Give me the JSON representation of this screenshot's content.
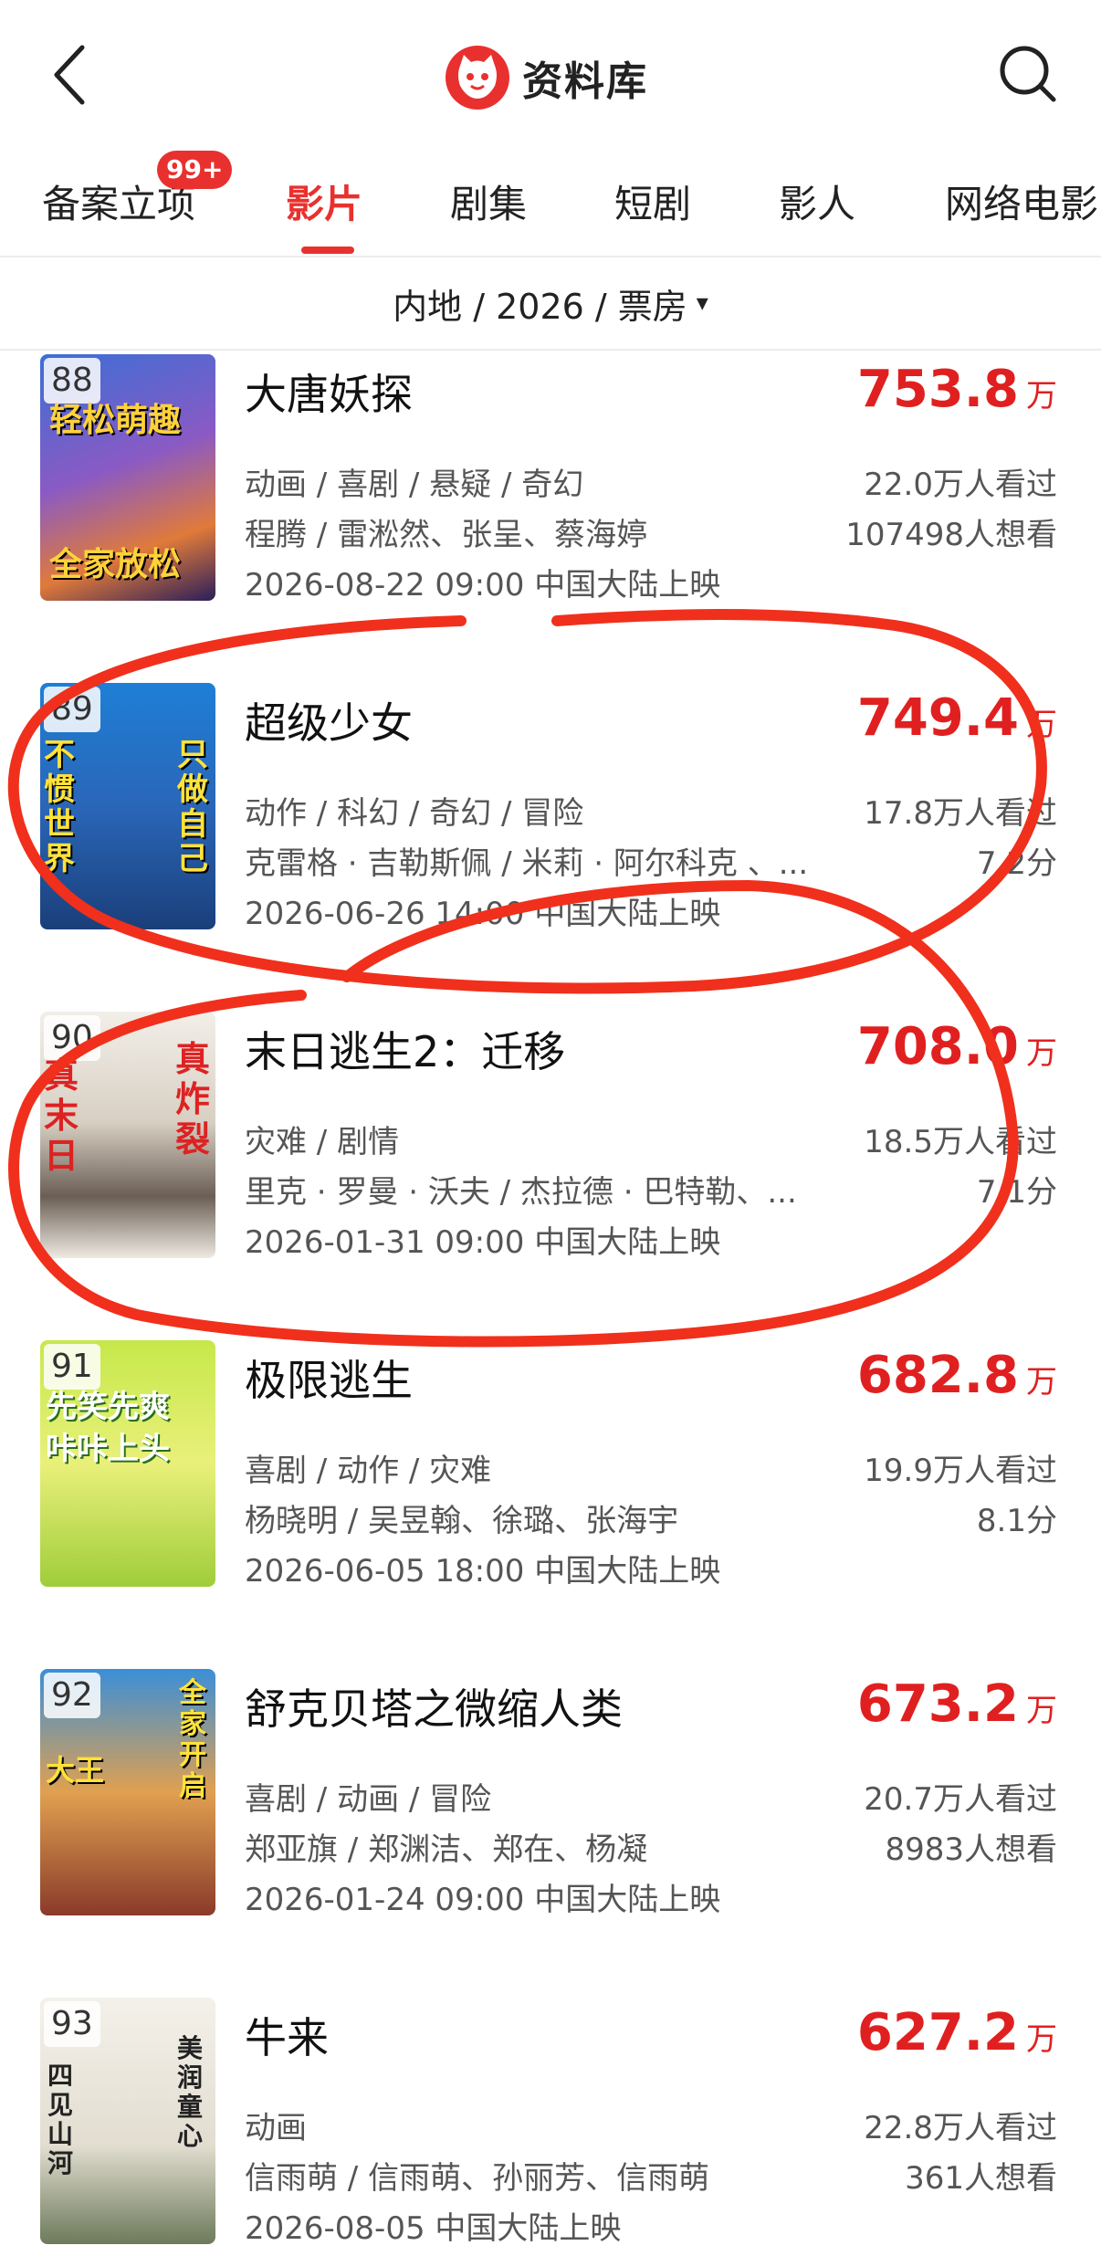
{
  "header": {
    "title": "资料库",
    "back_icon": "chevron-left-icon",
    "search_icon": "search-icon",
    "logo_icon": "cat-logo-icon"
  },
  "tabs": [
    {
      "label": "备案立项",
      "badge": "99+"
    },
    {
      "label": "影片"
    },
    {
      "label": "剧集"
    },
    {
      "label": "短剧"
    },
    {
      "label": "影人"
    },
    {
      "label": "网络电影"
    }
  ],
  "active_tab": "影片",
  "filter": {
    "label": "内地 / 2026 / 票房",
    "caret": "▾"
  },
  "colors": {
    "accent": "#e8312f",
    "box_office": "#e02020",
    "annotation": "#f0301c"
  },
  "movies": [
    {
      "rank": "88",
      "title": "大唐妖探",
      "box_office": "753.8",
      "unit": "万",
      "genres": "动画 / 喜剧 / 悬疑 / 奇幻",
      "people": "程腾 / 雷淞然、张呈、蔡海婷",
      "release": "2026-08-22 09:00 中国大陆上映",
      "watched": "22.0万人看过",
      "second": "107498人想看",
      "poster_text": [
        "轻松萌趣",
        "全家放松"
      ]
    },
    {
      "rank": "89",
      "title": "超级少女",
      "box_office": "749.4",
      "unit": "万",
      "genres": "动作 / 科幻 / 奇幻 / 冒险",
      "people": "克雷格 · 吉勒斯佩 / 米莉 · 阿尔科克 、...",
      "release": "2026-06-26 14:00 中国大陆上映",
      "watched": "17.8万人看过",
      "second": "7.2分",
      "poster_text": [
        "不惯世界",
        "只做自己"
      ]
    },
    {
      "rank": "90",
      "title": "末日逃生2：迁移",
      "box_office": "708.0",
      "unit": "万",
      "genres": "灾难 / 剧情",
      "people": "里克 · 罗曼 · 沃夫 / 杰拉德 · 巴特勒、...",
      "release": "2026-01-31 09:00 中国大陆上映",
      "watched": "18.5万人看过",
      "second": "7.1分",
      "poster_text": [
        "真末日",
        "真炸裂"
      ]
    },
    {
      "rank": "91",
      "title": "极限逃生",
      "box_office": "682.8",
      "unit": "万",
      "genres": "喜剧 / 动作 / 灾难",
      "people": "杨晓明 / 吴昱翰、徐璐、张海宇",
      "release": "2026-06-05 18:00 中国大陆上映",
      "watched": "19.9万人看过",
      "second": "8.1分",
      "poster_text": [
        "先笑先爽",
        "咔咔上头"
      ]
    },
    {
      "rank": "92",
      "title": "舒克贝塔之微缩人类",
      "box_office": "673.2",
      "unit": "万",
      "genres": "喜剧 / 动画 / 冒险",
      "people": "郑亚旗 / 郑渊洁、郑在、杨凝",
      "release": "2026-01-24 09:00 中国大陆上映",
      "watched": "20.7万人看过",
      "second": "8983人想看",
      "poster_text": [
        "大王",
        "全家开启"
      ]
    },
    {
      "rank": "93",
      "title": "牛来",
      "box_office": "627.2",
      "unit": "万",
      "genres": "动画",
      "people": "信雨萌 / 信雨萌、孙丽芳、信雨萌",
      "release": "2026-08-05 中国大陆上映",
      "watched": "22.8万人看过",
      "second": "361人想看",
      "poster_text": [
        "四见山河",
        "美润童心"
      ]
    }
  ]
}
